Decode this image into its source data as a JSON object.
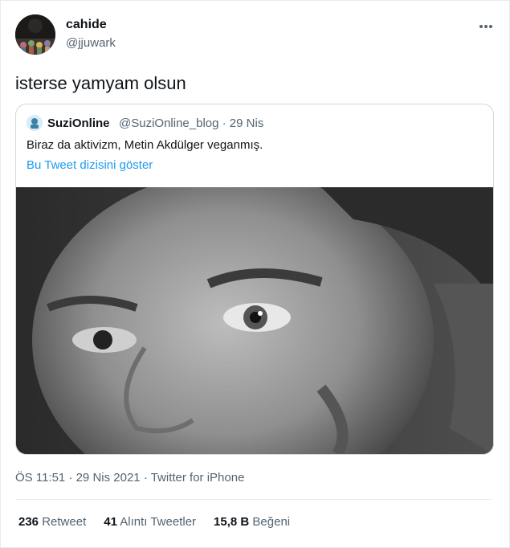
{
  "tweet": {
    "display_name": "cahide",
    "handle": "@jjuwark",
    "more_icon": "more-horizontal-icon",
    "text": "isterse yamyam olsun",
    "timestamp": "ÖS 11:51 · 29 Nis 2021 · Twitter for iPhone"
  },
  "quoted": {
    "display_name": "SuziOnline",
    "meta": "@SuziOnline_blog · 29 Nis",
    "text": "Biraz da aktivizm, Metin Akdülger veganmış.",
    "thread_link": "Bu Tweet dizisini göster"
  },
  "stats": [
    {
      "count": "236",
      "label": "Retweet"
    },
    {
      "count": "41",
      "label": "Alıntı Tweetler"
    },
    {
      "count": "15,8 B",
      "label": "Beğeni"
    }
  ],
  "colors": {
    "link": "#1d9bf0",
    "muted": "#536471",
    "border": "#cfd9de"
  }
}
